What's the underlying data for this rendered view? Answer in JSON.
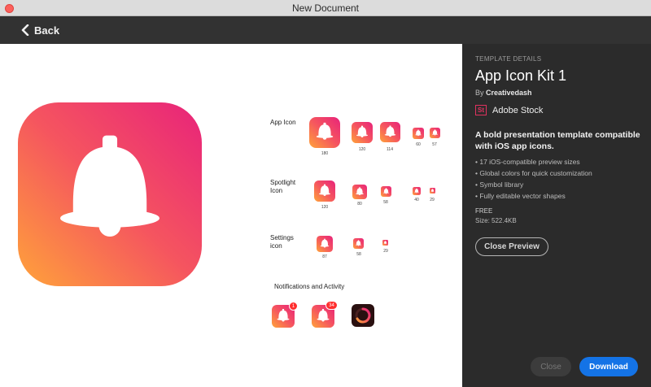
{
  "window": {
    "title": "New Document"
  },
  "toolbar": {
    "back_label": "Back"
  },
  "preview": {
    "sections": [
      {
        "label": "App Icon",
        "sizes": [
          "180",
          "120",
          "114",
          "60",
          "57"
        ]
      },
      {
        "label": "Spotlight Icon",
        "sizes": [
          "120",
          "80",
          "58",
          "40",
          "29"
        ]
      },
      {
        "label": "Settings icon",
        "sizes": [
          "87",
          "58",
          "29"
        ]
      },
      {
        "label": "Notifications and Activity",
        "badges": [
          "1",
          "34"
        ]
      }
    ]
  },
  "panel": {
    "section_label": "TEMPLATE DETAILS",
    "title": "App Icon Kit 1",
    "by_prefix": "By",
    "author": "Creativedash",
    "stock_badge": "St",
    "stock_name": "Adobe Stock",
    "description": "A bold presentation template compatible with iOS app icons.",
    "features": [
      "17 iOS-compatible preview sizes",
      "Global colors for quick customization",
      "Symbol library",
      "Fully editable vector shapes"
    ],
    "price": "FREE",
    "size": "Size: 522.4KB",
    "close_preview_label": "Close Preview",
    "close_label": "Close",
    "download_label": "Download"
  },
  "colors": {
    "gradient_start": "#ffa33a",
    "gradient_mid": "#f5555f",
    "gradient_end": "#e8237a",
    "accent_blue": "#1473e6",
    "stock_red": "#e0325f"
  }
}
